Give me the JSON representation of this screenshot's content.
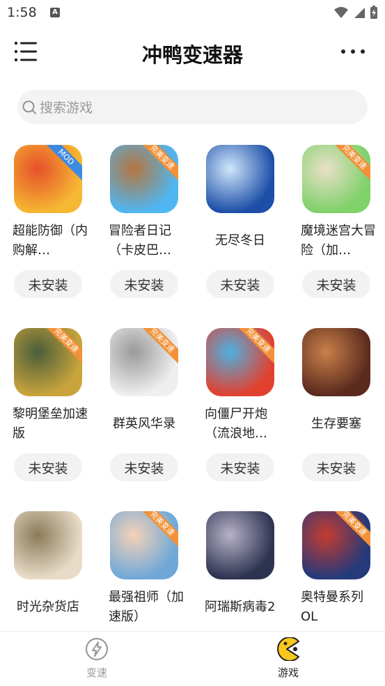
{
  "status": {
    "time": "1:58",
    "notif_letter": "A"
  },
  "header": {
    "title": "冲鸭变速器"
  },
  "search": {
    "placeholder": "搜索游戏"
  },
  "games": [
    {
      "name": "超能防御（内购解锁）",
      "display": "超能防御（内购解…",
      "action": "未安装",
      "badge": "MOD",
      "color1": "#f6b733",
      "color2": "#e6502a"
    },
    {
      "name": "冒险者日记（卡皮巴拉）",
      "display": "冒险者日记（卡皮巴…",
      "action": "未安装",
      "badge": "完美变速",
      "color1": "#4fb6f2",
      "color2": "#b5763e"
    },
    {
      "name": "无尽冬日",
      "display": "无尽冬日",
      "action": "未安装",
      "badge": "",
      "color1": "#1d4fa8",
      "color2": "#cfe6fb"
    },
    {
      "name": "魔境迷宫大冒险（加速版）",
      "display": "魔境迷宫大冒险（加…",
      "action": "未安装",
      "badge": "完美变速",
      "color1": "#7fd16a",
      "color2": "#e9e0c8"
    },
    {
      "name": "黎明堡垒加速版",
      "display": "黎明堡垒加速版",
      "action": "未安装",
      "badge": "完美变速",
      "color1": "#c9a43c",
      "color2": "#4a5d3a"
    },
    {
      "name": "群英风华录",
      "display": "群英风华录",
      "action": "未安装",
      "badge": "完美变速",
      "color1": "#efefef",
      "color2": "#9a9a9a"
    },
    {
      "name": "向僵尸开炮（流浪地球）",
      "display": "向僵尸开炮（流浪地…",
      "action": "未安装",
      "badge": "完美变速",
      "color1": "#e2402f",
      "color2": "#4fb0e0"
    },
    {
      "name": "生存要塞",
      "display": "生存要塞",
      "action": "未安装",
      "badge": "",
      "color1": "#5a2a1d",
      "color2": "#c9804a"
    },
    {
      "name": "时光杂货店",
      "display": "时光杂货店",
      "action": "未安装",
      "badge": "",
      "color1": "#e8dcc8",
      "color2": "#8c7b5a"
    },
    {
      "name": "最强祖师（加速版）",
      "display": "最强祖师（加速版）",
      "action": "未安装",
      "badge": "完美变速",
      "color1": "#6fa8d8",
      "color2": "#f4d2b8"
    },
    {
      "name": "阿瑞斯病毒2",
      "display": "阿瑞斯病毒2",
      "action": "未安装",
      "badge": "",
      "color1": "#2d3350",
      "color2": "#b7b2c8"
    },
    {
      "name": "奥特曼系列OL",
      "display": "奥特曼系列OL",
      "action": "未安装",
      "badge": "完美变速",
      "color1": "#243a7a",
      "color2": "#c63b2f"
    }
  ],
  "tabs": [
    {
      "label": "变速",
      "active": false
    },
    {
      "label": "游戏",
      "active": true
    }
  ],
  "colors": {
    "accent": "#f8c81c",
    "inactive": "#9a9a9a"
  }
}
